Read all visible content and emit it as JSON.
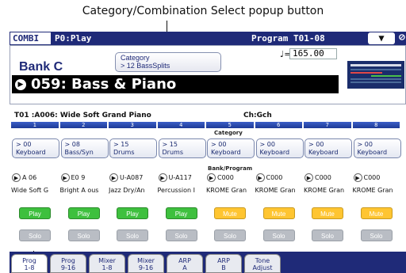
{
  "callout": "Category/Combination Select popup button",
  "topbar": {
    "mode": "COMBI",
    "page": "P0:Play",
    "program": "Program T01-08",
    "menu": "▼",
    "lock_icon": "lock-icon"
  },
  "info": {
    "bank": "Bank C",
    "category_label": "Category",
    "category_value": "> 12 BassSplits",
    "tempo_symbol": "♩=",
    "tempo": "165.00",
    "name": "059: Bass & Piano"
  },
  "track_info": {
    "track": "T01 :A006: Wide Soft Grand Piano",
    "channel": "Ch:Gch"
  },
  "section_labels": {
    "category": "Category",
    "bank_program": "Bank/Program"
  },
  "tracks": [
    {
      "num": "1",
      "cat_num": "> 00",
      "cat_name": "Keyboard",
      "bank": "A  06",
      "name": "Wide Soft G",
      "play": "Play",
      "solo": "Solo",
      "state": "play"
    },
    {
      "num": "2",
      "cat_num": "> 08",
      "cat_name": "Bass/Syn",
      "bank": "E0 9",
      "name": "Bright A ous",
      "play": "Play",
      "solo": "Solo",
      "state": "play"
    },
    {
      "num": "3",
      "cat_num": "> 15",
      "cat_name": "Drums",
      "bank": "U-A087",
      "name": "Jazz Dry/An",
      "play": "Play",
      "solo": "Solo",
      "state": "play"
    },
    {
      "num": "4",
      "cat_num": "> 15",
      "cat_name": "Drums",
      "bank": "U-A117",
      "name": "Percussion I",
      "play": "Play",
      "solo": "Solo",
      "state": "play"
    },
    {
      "num": "5",
      "cat_num": "> 00",
      "cat_name": "Keyboard",
      "bank": "C000",
      "name": "KROME Gran",
      "play": "Mute",
      "solo": "Solo",
      "state": "mute"
    },
    {
      "num": "6",
      "cat_num": "> 00",
      "cat_name": "Keyboard",
      "bank": "C000",
      "name": "KROME Gran",
      "play": "Mute",
      "solo": "Solo",
      "state": "mute"
    },
    {
      "num": "7",
      "cat_num": "> 00",
      "cat_name": "Keyboard",
      "bank": "C000",
      "name": "KROME Gran",
      "play": "Mute",
      "solo": "Solo",
      "state": "mute"
    },
    {
      "num": "8",
      "cat_num": "> 00",
      "cat_name": "Keyboard",
      "bank": "C000",
      "name": "KROME Gran",
      "play": "Mute",
      "solo": "Solo",
      "state": "mute"
    }
  ],
  "tabs": [
    {
      "l1": "Prog",
      "l2": "1-8"
    },
    {
      "l1": "Prog",
      "l2": "9-16"
    },
    {
      "l1": "Mixer",
      "l2": "1-8"
    },
    {
      "l1": "Mixer",
      "l2": "9-16"
    },
    {
      "l1": "ARP",
      "l2": "A"
    },
    {
      "l1": "ARP",
      "l2": "B"
    },
    {
      "l1": "Tone",
      "l2": "Adjust"
    }
  ],
  "colors": {
    "accent": "#1f2a78",
    "play": "#3ec03e",
    "mute": "#ffc531",
    "solo": "#b9bdc4"
  }
}
